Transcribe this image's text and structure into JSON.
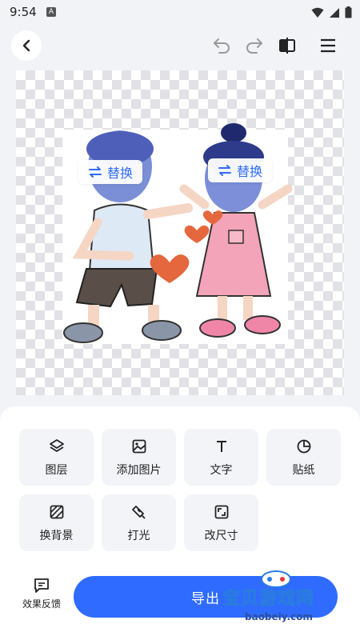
{
  "status": {
    "time": "9:54",
    "notification_letter": "A"
  },
  "toolbar": {
    "back_icon": "chevron-left-icon",
    "undo_icon": "undo-icon",
    "redo_icon": "redo-icon",
    "compare_icon": "compare-icon",
    "menu_icon": "menu-icon"
  },
  "canvas": {
    "replace_buttons": [
      {
        "label": "替换"
      },
      {
        "label": "替换"
      }
    ]
  },
  "tools": [
    {
      "label": "图层",
      "icon": "layers-icon"
    },
    {
      "label": "添加图片",
      "icon": "image-icon"
    },
    {
      "label": "文字",
      "icon": "text-icon"
    },
    {
      "label": "贴纸",
      "icon": "sticker-icon"
    },
    {
      "label": "换背景",
      "icon": "background-icon"
    },
    {
      "label": "打光",
      "icon": "lighting-icon"
    },
    {
      "label": "改尺寸",
      "icon": "resize-icon"
    }
  ],
  "footer": {
    "feedback_label": "效果反馈",
    "export_label": "导出"
  },
  "watermark": {
    "text": "宝贝游戏网",
    "domain": "baobeiy.com"
  },
  "colors": {
    "accent": "#2f6bff",
    "tool_bg": "#f3f4f8",
    "page_bg": "#f2f3f7"
  }
}
